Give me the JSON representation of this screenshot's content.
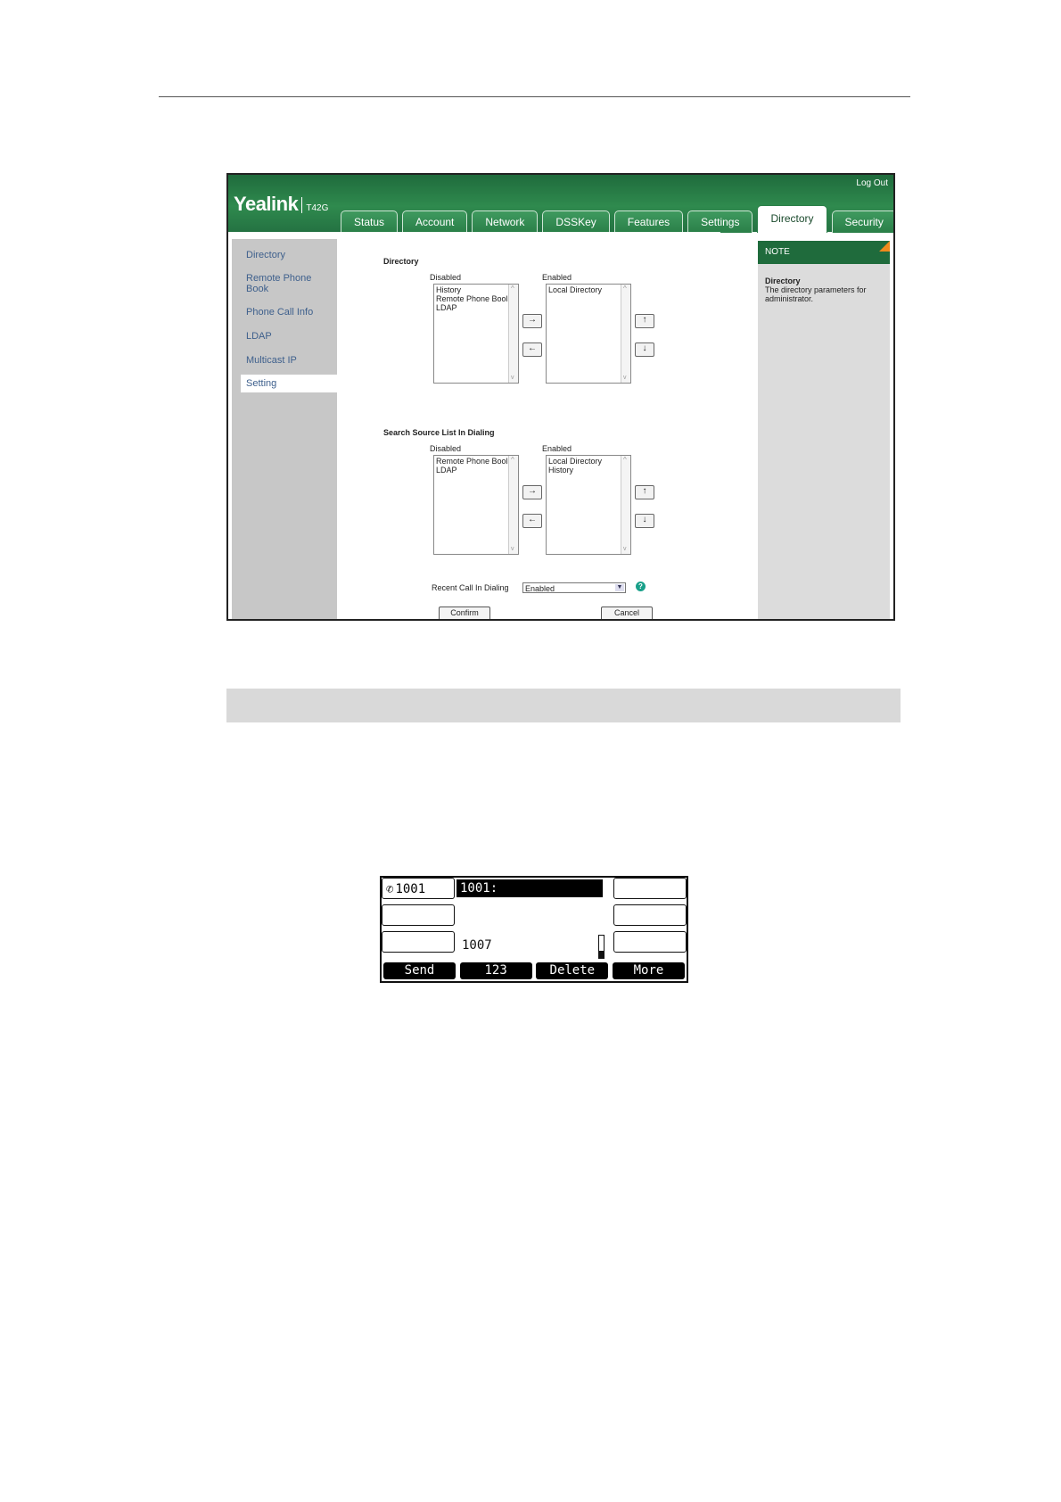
{
  "webui": {
    "logo": "Yealink",
    "model": "T42G",
    "logout": "Log Out",
    "tabs": [
      "Status",
      "Account",
      "Network",
      "DSSKey",
      "Features",
      "Settings",
      "Directory",
      "Security"
    ],
    "active_tab": "Directory",
    "sidebar": [
      "Directory",
      "Remote Phone Book",
      "Phone Call Info",
      "LDAP",
      "Multicast IP",
      "Setting"
    ],
    "active_sidebar": "Setting",
    "directory": {
      "title": "Directory",
      "disabled_label": "Disabled",
      "enabled_label": "Enabled",
      "disabled_items": [
        "History",
        "Remote Phone Bool",
        "LDAP"
      ],
      "enabled_items": [
        "Local Directory"
      ]
    },
    "search_source": {
      "title": "Search Source List In Dialing",
      "disabled_label": "Disabled",
      "enabled_label": "Enabled",
      "disabled_items": [
        "Remote Phone Bool",
        "LDAP"
      ],
      "enabled_items": [
        "Local Directory",
        "History"
      ]
    },
    "buttons": {
      "move_right": "→",
      "move_left": "←",
      "move_up": "↑",
      "move_down": "↓"
    },
    "recent_call": {
      "label": "Recent Call In Dialing",
      "value": "Enabled"
    },
    "help": "?",
    "confirm": "Confirm",
    "cancel": "Cancel",
    "note": {
      "header": "NOTE",
      "title": "Directory",
      "text": "The directory parameters for administrator."
    }
  },
  "phone": {
    "line_key": "1001",
    "title": "1001:",
    "entry": "1007",
    "softkeys": [
      "Send",
      "123",
      "Delete",
      "More"
    ]
  }
}
